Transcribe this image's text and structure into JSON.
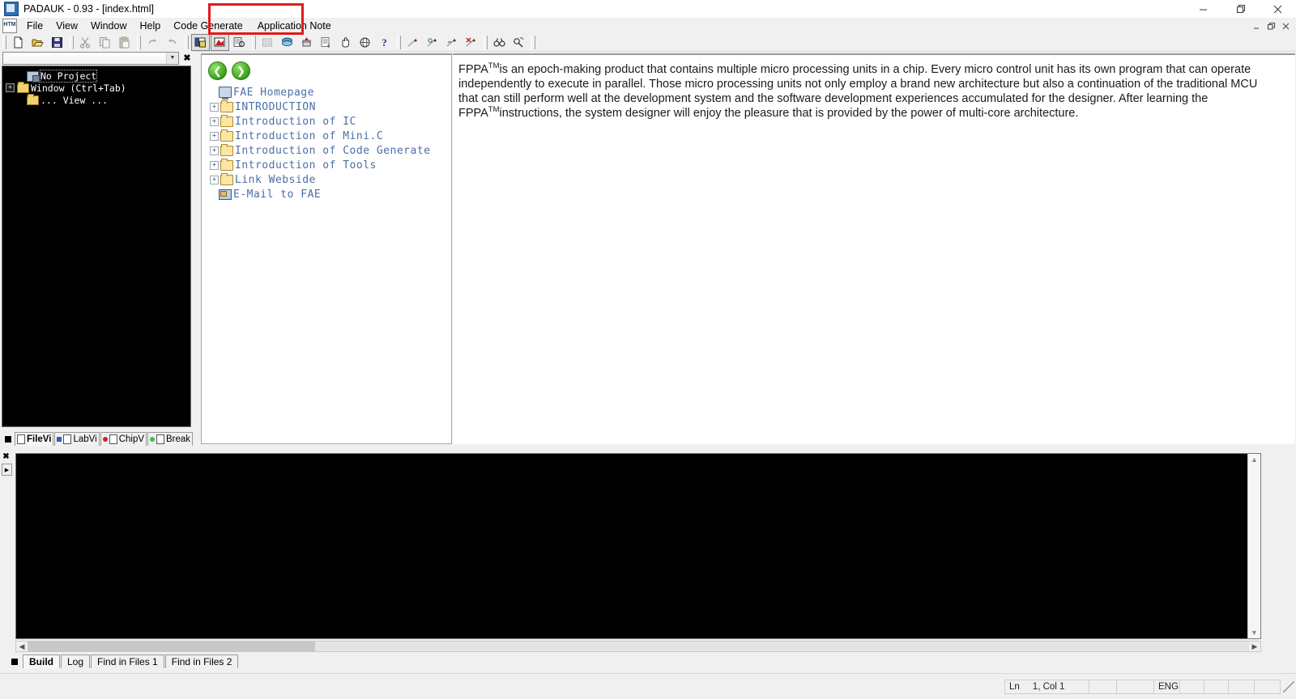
{
  "window": {
    "title": "PADAUK - 0.93 - [index.html]",
    "app_icon": "padauk-icon",
    "minimize": "—",
    "maximize": "❑",
    "close": "✕",
    "mdi_minimize": "_",
    "mdi_restore": "❐",
    "mdi_close": "✕"
  },
  "menu": {
    "items": [
      {
        "label": "File",
        "name": "menu-file"
      },
      {
        "label": "View",
        "name": "menu-view"
      },
      {
        "label": "Window",
        "name": "menu-window"
      },
      {
        "label": "Help",
        "name": "menu-help"
      },
      {
        "label": "Code Generate",
        "name": "menu-code-generate"
      },
      {
        "label": "Application Note",
        "name": "menu-application-note"
      }
    ],
    "highlight_color": "#e01b1b"
  },
  "toolbar": {
    "buttons": [
      {
        "name": "new-file-button",
        "icon": "new-document-icon"
      },
      {
        "name": "open-file-button",
        "icon": "open-folder-icon"
      },
      {
        "name": "save-file-button",
        "icon": "save-disk-icon"
      },
      {
        "name": "cut-button",
        "icon": "scissors-icon"
      },
      {
        "name": "copy-button",
        "icon": "copy-icon"
      },
      {
        "name": "paste-button",
        "icon": "paste-icon"
      },
      {
        "name": "redo-button",
        "icon": "redo-arrow-icon"
      },
      {
        "name": "undo-button",
        "icon": "undo-arrow-icon"
      },
      {
        "name": "toggle-project-panel-button",
        "icon": "panel-icon"
      },
      {
        "name": "toggle-output-panel-button",
        "icon": "output-panel-icon"
      },
      {
        "name": "build-all-button",
        "icon": "build-icon"
      },
      {
        "name": "compile-button",
        "icon": "grid-icon"
      },
      {
        "name": "burn-button",
        "icon": "layers-icon"
      },
      {
        "name": "emulate-button",
        "icon": "chip-icon"
      },
      {
        "name": "list-button",
        "icon": "list-icon"
      },
      {
        "name": "hand-button",
        "icon": "hand-icon"
      },
      {
        "name": "globe-button",
        "icon": "globe-icon"
      },
      {
        "name": "help-button",
        "icon": "question-mark-icon"
      },
      {
        "name": "run-button",
        "icon": "run-icon"
      },
      {
        "name": "step-into-button",
        "icon": "step-into-icon"
      },
      {
        "name": "step-over-button",
        "icon": "step-over-icon"
      },
      {
        "name": "stop-debug-button",
        "icon": "stop-debug-icon"
      },
      {
        "name": "find-button",
        "icon": "binoculars-icon"
      },
      {
        "name": "find-next-button",
        "icon": "find-next-icon"
      }
    ]
  },
  "project_panel": {
    "combo_value": "",
    "close_label": "✖",
    "tree": [
      {
        "label": "No Project",
        "icon": "project-icon",
        "expander": "",
        "selected": true,
        "indent": 1
      },
      {
        "label": "Window (Ctrl+Tab)",
        "icon": "folder-icon",
        "expander": "+",
        "selected": false,
        "indent": 0
      },
      {
        "label": "... View ...",
        "icon": "folder-icon",
        "expander": "",
        "selected": false,
        "indent": 1
      }
    ],
    "tabs": [
      {
        "label": "FileVi",
        "name": "tab-file-view",
        "active": true,
        "dot": ""
      },
      {
        "label": "LabVi",
        "name": "tab-lab-view",
        "active": false,
        "dot": "#2a5ec8"
      },
      {
        "label": "ChipV",
        "name": "tab-chip-view",
        "active": false,
        "dot": "#d42020"
      },
      {
        "label": "Break",
        "name": "tab-breakpoint-view",
        "active": false,
        "dot": "#3cc040"
      }
    ]
  },
  "navigator": {
    "back_label": "←",
    "forward_label": "→",
    "items": [
      {
        "label": "FAE Homepage",
        "icon": "monitor-icon",
        "expander": "",
        "name": "nav-fae-homepage"
      },
      {
        "label": "INTRODUCTION",
        "icon": "folder-icon",
        "expander": "+",
        "name": "nav-introduction"
      },
      {
        "label": "Introduction of IC",
        "icon": "folder-icon",
        "expander": "+",
        "name": "nav-introduction-of-ic"
      },
      {
        "label": "Introduction of Mini.C",
        "icon": "folder-icon",
        "expander": "+",
        "name": "nav-introduction-of-minic"
      },
      {
        "label": "Introduction of Code Generate",
        "icon": "folder-icon",
        "expander": "+",
        "name": "nav-introduction-of-code-generate"
      },
      {
        "label": "Introduction of Tools",
        "icon": "folder-icon",
        "expander": "+",
        "name": "nav-introduction-of-tools"
      },
      {
        "label": "Link Webside",
        "icon": "folder-icon",
        "expander": "+",
        "name": "nav-link-webside"
      },
      {
        "label": "E-Mail to FAE",
        "icon": "mail-icon",
        "expander": "",
        "name": "nav-email-to-fae"
      }
    ]
  },
  "content": {
    "paragraph_part1": "FPPA",
    "sup1": "TM",
    "paragraph_part2": "is an epoch-making product that contains multiple micro processing units in a chip. Every micro control unit has its own program that can operate independently to execute in parallel. Those micro processing units not only employ a brand new architecture but also a continuation of the traditional MCU that can still perform well at the development system and the software development experiences accumulated for the designer. After learning the FPPA",
    "sup2": "TM",
    "paragraph_part3": "instructions, the system designer will enjoy the pleasure that is provided by the power of multi-core architecture."
  },
  "output_panel": {
    "close_label": "✖",
    "expand_label": "▶",
    "console_text": "",
    "scroll_left": "‹",
    "scroll_right": "›",
    "scroll_up": "˄",
    "scroll_down": "˅",
    "tabs": [
      {
        "label": "Build",
        "name": "tab-build",
        "active": true
      },
      {
        "label": "Log",
        "name": "tab-log",
        "active": false
      },
      {
        "label": "Find in Files 1",
        "name": "tab-find-in-files-1",
        "active": false
      },
      {
        "label": "Find in Files 2",
        "name": "tab-find-in-files-2",
        "active": false
      }
    ]
  },
  "statusbar": {
    "line_label": "Ln",
    "position": "1, Col 1",
    "language": "ENG",
    "cells": [
      "",
      "",
      "",
      ""
    ]
  }
}
